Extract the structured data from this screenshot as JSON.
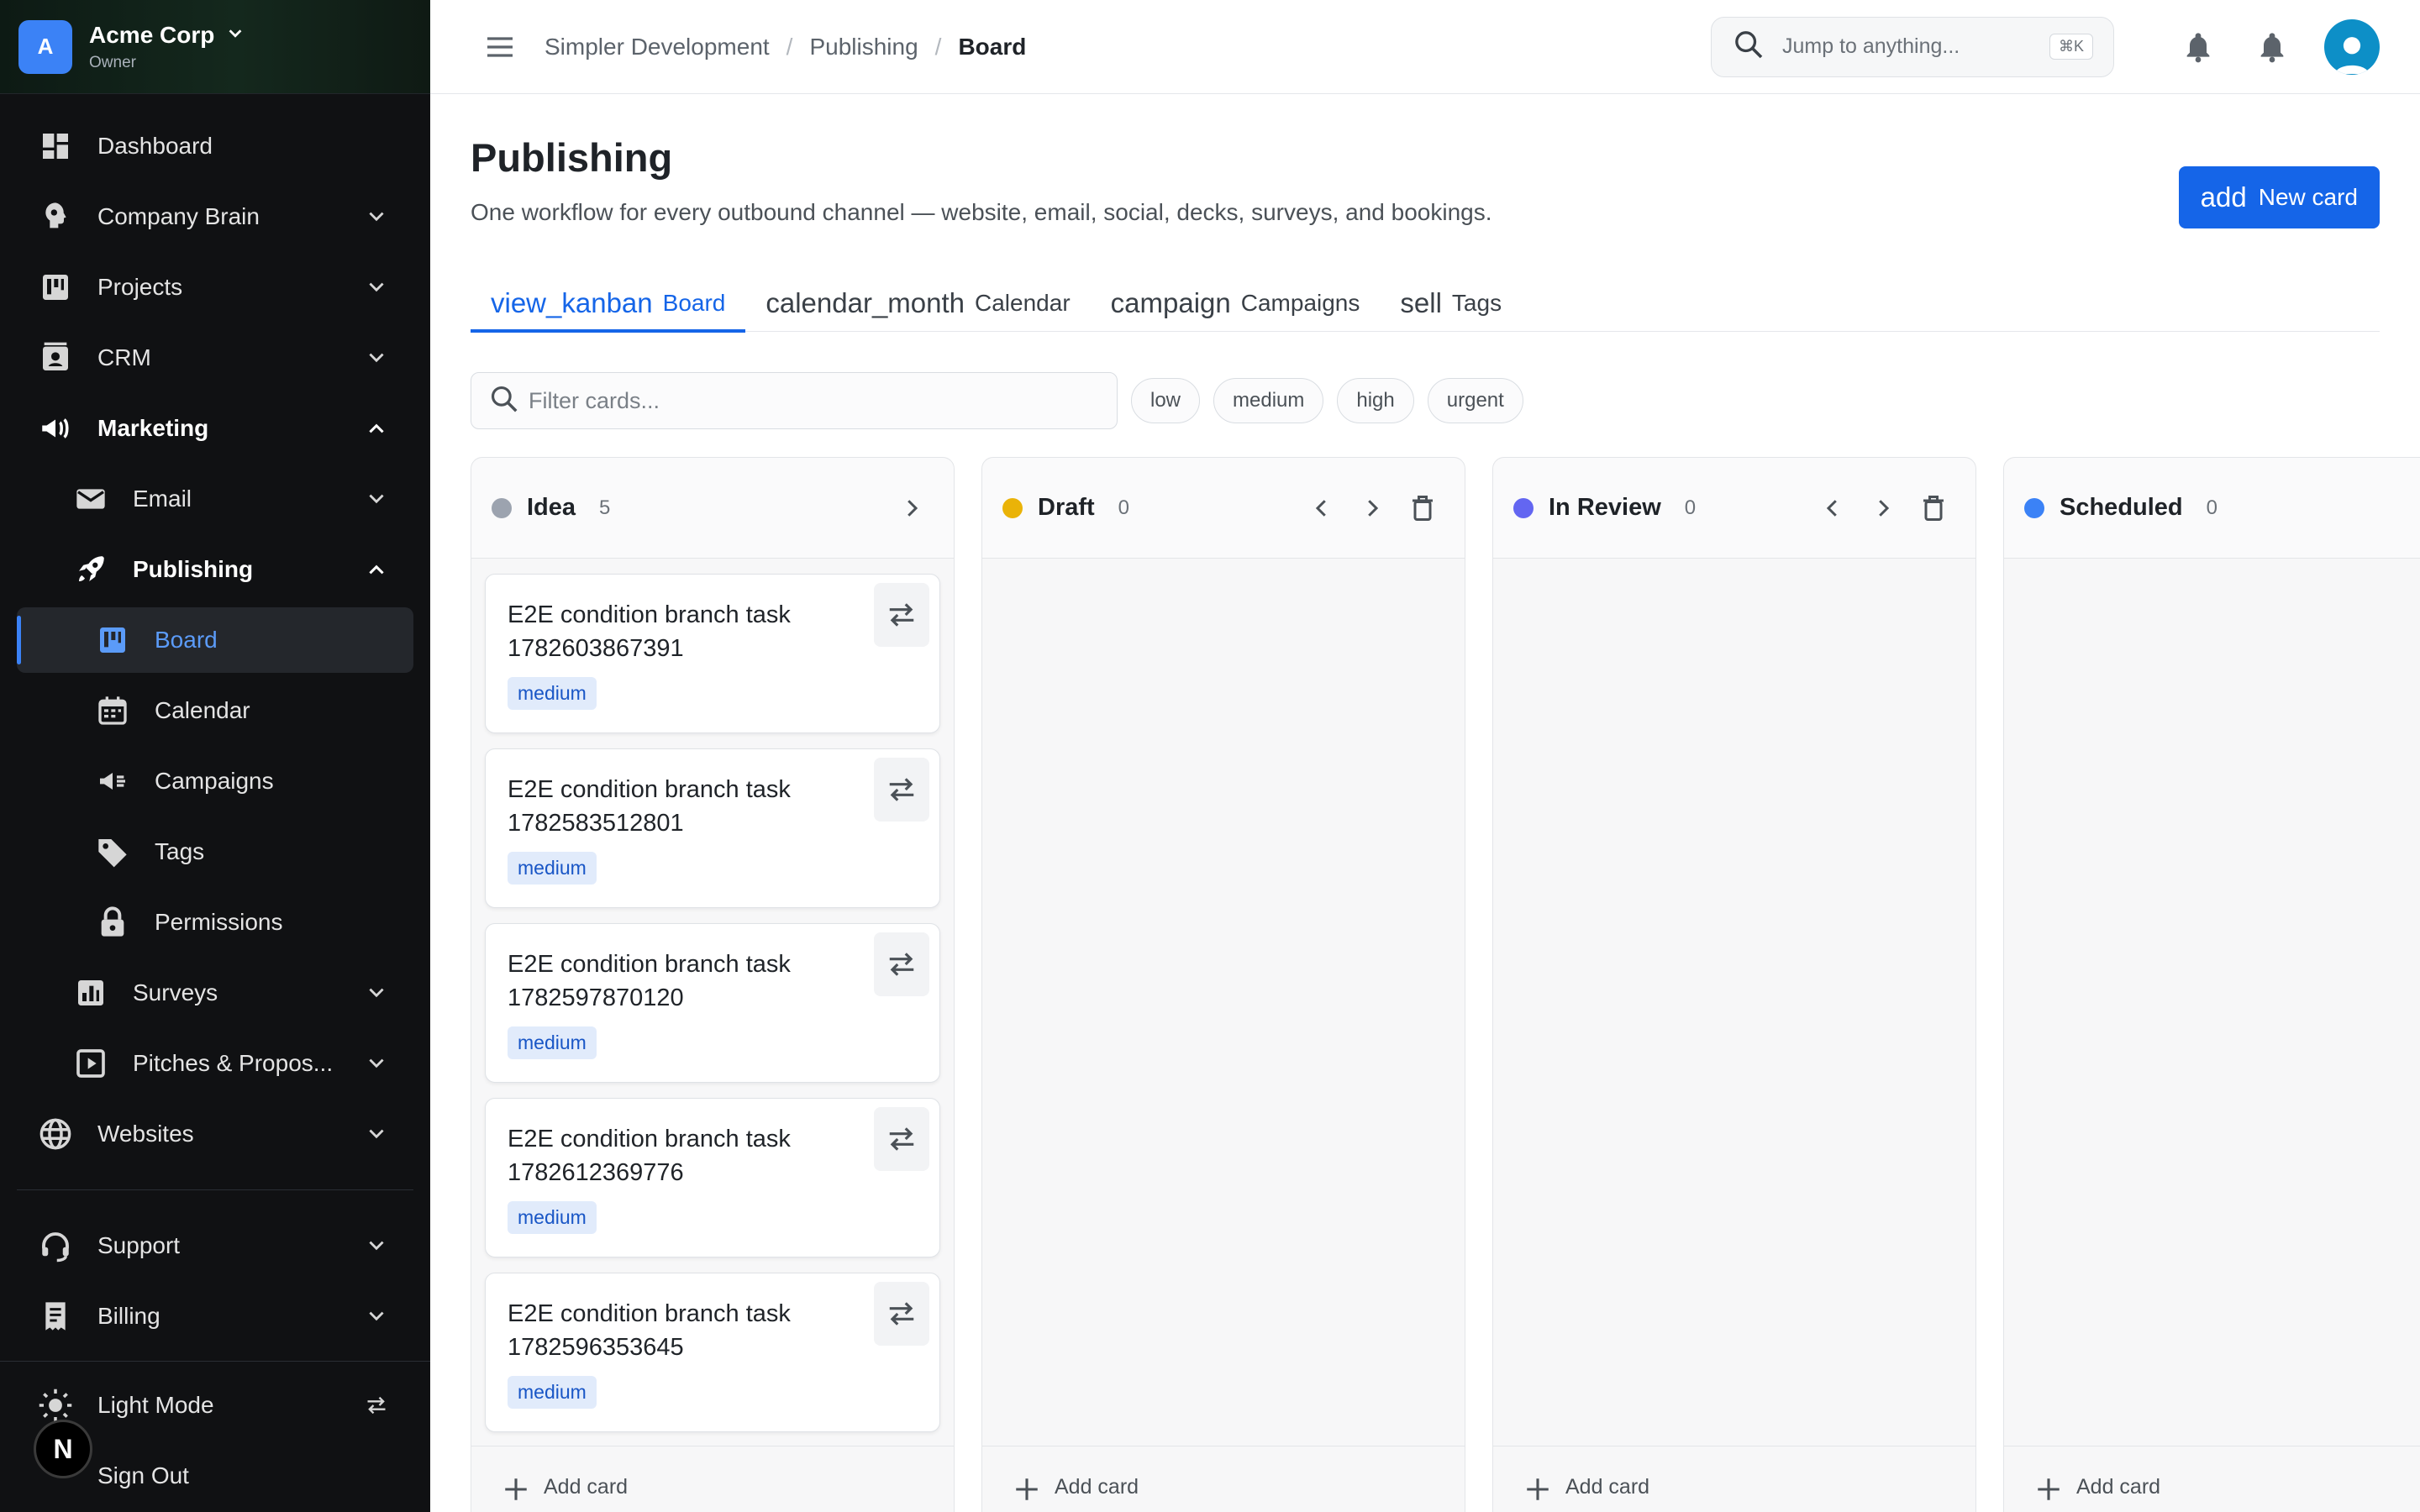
{
  "org": {
    "initial": "A",
    "name": "Acme Corp",
    "role": "Owner"
  },
  "sidebar": {
    "items": [
      {
        "label": "Dashboard",
        "icon": "dashboard-icon"
      },
      {
        "label": "Company Brain",
        "icon": "brain-icon"
      },
      {
        "label": "Projects",
        "icon": "kanban-icon"
      },
      {
        "label": "CRM",
        "icon": "contact-card-icon"
      },
      {
        "label": "Marketing",
        "icon": "megaphone-icon"
      },
      {
        "label": "Email",
        "icon": "mail-icon"
      },
      {
        "label": "Publishing",
        "icon": "rocket-icon"
      },
      {
        "label": "Board",
        "icon": "kanban-icon"
      },
      {
        "label": "Calendar",
        "icon": "calendar-icon"
      },
      {
        "label": "Campaigns",
        "icon": "megaphone-icon"
      },
      {
        "label": "Tags",
        "icon": "tag-icon"
      },
      {
        "label": "Permissions",
        "icon": "lock-icon"
      },
      {
        "label": "Surveys",
        "icon": "bar-chart-icon"
      },
      {
        "label": "Pitches & Propos...",
        "icon": "slideshow-icon"
      },
      {
        "label": "Websites",
        "icon": "globe-icon"
      },
      {
        "label": "Support",
        "icon": "headset-icon"
      },
      {
        "label": "Billing",
        "icon": "receipt-icon"
      }
    ],
    "footer": {
      "theme_label": "Light Mode",
      "signout_label": "Sign Out",
      "badge": "N"
    }
  },
  "topbar": {
    "breadcrumbs": [
      "Simpler Development",
      "Publishing",
      "Board"
    ],
    "search_placeholder": "Jump to anything...",
    "shortcut": "⌘K"
  },
  "page": {
    "title": "Publishing",
    "subtitle": "One workflow for every outbound channel — website, email, social, decks, surveys, and bookings.",
    "new_card": {
      "icon_text": "add",
      "label": "New card"
    }
  },
  "tabs": [
    {
      "icon_text": "view_kanban",
      "label": "Board"
    },
    {
      "icon_text": "calendar_month",
      "label": "Calendar"
    },
    {
      "icon_text": "campaign",
      "label": "Campaigns"
    },
    {
      "icon_text": "sell",
      "label": "Tags"
    }
  ],
  "filter": {
    "placeholder": "Filter cards...",
    "chips": [
      "low",
      "medium",
      "high",
      "urgent"
    ]
  },
  "columns": [
    {
      "title": "Idea",
      "count": "5",
      "color": "#9ca3af",
      "cards": [
        {
          "title": "E2E condition branch task 1782603867391",
          "priority": "medium"
        },
        {
          "title": "E2E condition branch task 1782583512801",
          "priority": "medium"
        },
        {
          "title": "E2E condition branch task 1782597870120",
          "priority": "medium"
        },
        {
          "title": "E2E condition branch task 1782612369776",
          "priority": "medium"
        },
        {
          "title": "E2E condition branch task 1782596353645",
          "priority": "medium"
        }
      ]
    },
    {
      "title": "Draft",
      "count": "0",
      "color": "#eab308",
      "cards": []
    },
    {
      "title": "In Review",
      "count": "0",
      "color": "#6366f1",
      "cards": []
    },
    {
      "title": "Scheduled",
      "count": "0",
      "color": "#3b82f6",
      "cards": []
    }
  ],
  "add_card_label": "Add card",
  "colors": {
    "accent": "#1565e8",
    "sidebar_bg": "#101113"
  }
}
